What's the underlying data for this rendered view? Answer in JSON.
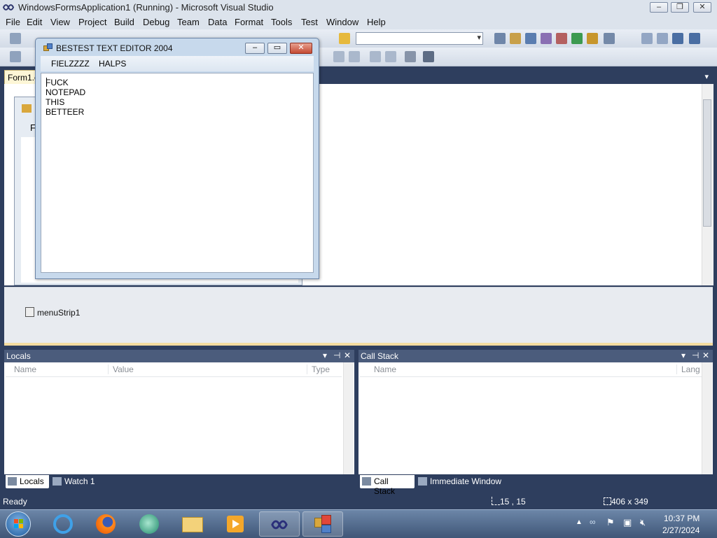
{
  "vs": {
    "title": "WindowsFormsApplication1 (Running) - Microsoft Visual Studio",
    "menu": [
      "File",
      "Edit",
      "View",
      "Project",
      "Build",
      "Debug",
      "Team",
      "Data",
      "Format",
      "Tools",
      "Test",
      "Window",
      "Help"
    ],
    "doc_tab": "Form1.c",
    "designer_menu_fragment": "F",
    "tray_component": "menuStrip1",
    "status": {
      "left": "Ready",
      "position": "15 , 15",
      "size": "406 x 349"
    }
  },
  "locals": {
    "title": "Locals",
    "columns": [
      "Name",
      "Value",
      "Type"
    ],
    "tabs": [
      "Locals",
      "Watch 1"
    ]
  },
  "callstack": {
    "title": "Call Stack",
    "columns": [
      "Name",
      "Lang"
    ],
    "tabs": [
      "Call Stack",
      "Immediate Window"
    ]
  },
  "app": {
    "title": "BESTEST TEXT EDITOR 2004",
    "menu": [
      "FIELZZZZ",
      "HALPS"
    ],
    "text": "FUCK NOTEPAD THIS BETTEER"
  },
  "taskbar": {
    "time": "10:37 PM",
    "date": "2/27/2024"
  },
  "colors": {
    "vs_chrome": "#2e3e5e",
    "toolwindow_header": "#4b5c7c",
    "app_frame": "#c7d9ec"
  }
}
